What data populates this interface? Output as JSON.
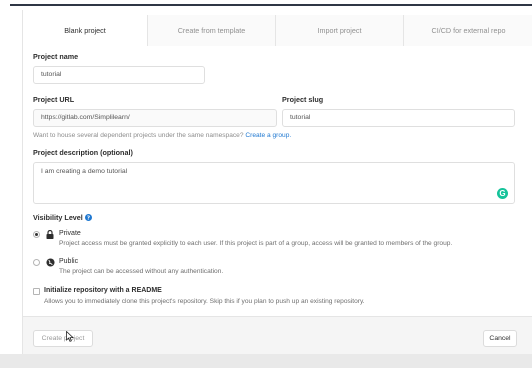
{
  "tabs": [
    "Blank project",
    "Create from template",
    "Import project",
    "CI/CD for external repo"
  ],
  "project_name": {
    "label": "Project name",
    "value": "tutorial"
  },
  "project_url": {
    "label": "Project URL",
    "value": "https://gitlab.com/Simplilearn/"
  },
  "project_slug": {
    "label": "Project slug",
    "value": "tutorial"
  },
  "namespace_help": {
    "text": "Want to house several dependent projects under the same namespace?",
    "link": "Create a group."
  },
  "description": {
    "label": "Project description (optional)",
    "value": "I am creating a demo tutorial"
  },
  "visibility": {
    "label": "Visibility Level",
    "options": [
      {
        "title": "Private",
        "desc": "Project access must be granted explicitly to each user. If this project is part of a group, access will be granted to members of the group.",
        "checked": true
      },
      {
        "title": "Public",
        "desc": "The project can be accessed without any authentication.",
        "checked": false
      }
    ]
  },
  "readme": {
    "title": "Initialize repository with a README",
    "desc": "Allows you to immediately clone this project's repository. Skip this if you plan to push up an existing repository."
  },
  "buttons": {
    "create": "Create project",
    "cancel": "Cancel"
  },
  "colors": {
    "link": "#1f78d1",
    "help_icon": "#1f78d1",
    "grammarly": "#15c39a"
  }
}
